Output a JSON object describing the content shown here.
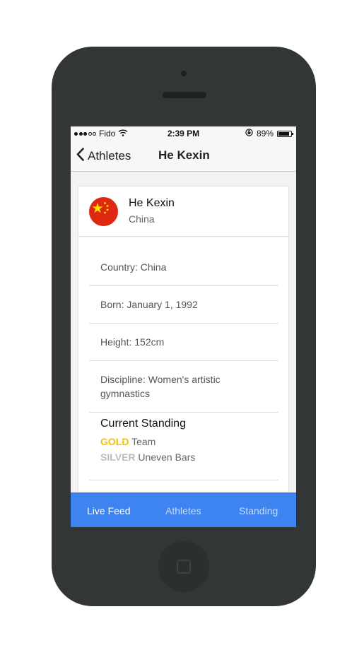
{
  "status_bar": {
    "carrier": "Fido",
    "time": "2:39 PM",
    "battery": "89%",
    "battery_level": 0.89,
    "signal_bars": 3,
    "signal_total": 5
  },
  "nav": {
    "back_label": "Athletes",
    "title": "He Kexin"
  },
  "athlete": {
    "name": "He Kexin",
    "country": "China",
    "flag_icon": "china-flag-icon"
  },
  "details": [
    "Country: China",
    "Born: January 1, 1992",
    "Height: 152cm",
    "Discipline: Women's artistic gymnastics"
  ],
  "standing": {
    "title": "Current Standing",
    "medals": [
      {
        "medal": "GOLD",
        "event": "Team",
        "color": "#f2c200"
      },
      {
        "medal": "SILVER",
        "event": "Uneven Bars",
        "color": "#bdbdbd"
      }
    ]
  },
  "tabs": [
    {
      "label": "Live Feed",
      "active": true
    },
    {
      "label": "Athletes",
      "active": false
    },
    {
      "label": "Standing",
      "active": false
    }
  ],
  "colors": {
    "accent": "#3d84f0",
    "phone_body": "#333637"
  }
}
